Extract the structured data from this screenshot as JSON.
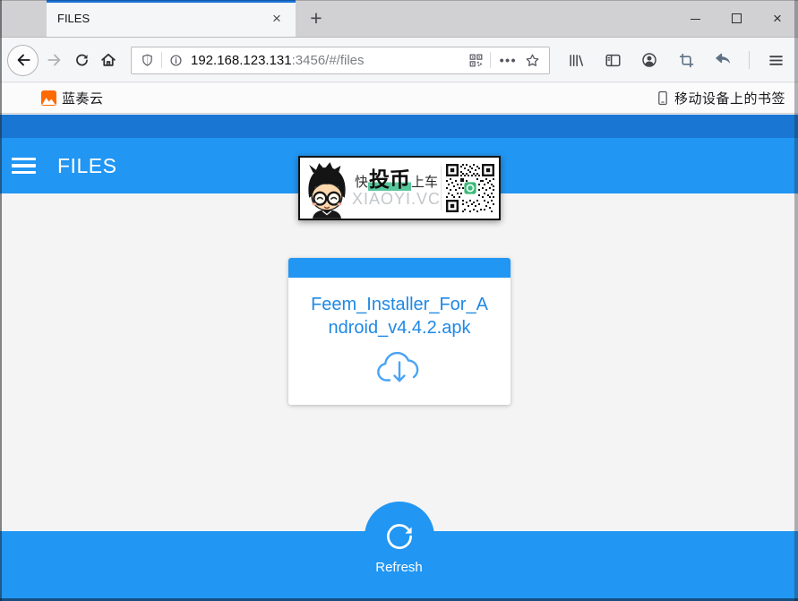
{
  "browser": {
    "tabbar": {
      "active_tab_title": "FILES"
    },
    "urlbar": {
      "host": "192.168.123.131",
      "path": ":3456/#/files"
    }
  },
  "bookmarks_bar": {
    "left_item_label": "蓝奏云",
    "right_item_label": "移动设备上的书签"
  },
  "app": {
    "header_title": "FILES",
    "banner": {
      "tagline_prefix": "快",
      "tagline_highlight": "投币",
      "tagline_suffix": "上车",
      "site": "XIAOYI.VC"
    },
    "file_card": {
      "filename": "Feem_Installer_For_Android_v4.4.2.apk"
    },
    "footer": {
      "refresh_label": "Refresh"
    }
  },
  "icons": {
    "new_tab": "+",
    "tab_close": "×",
    "window_close": "×",
    "page_actions_dots": "•••"
  },
  "colors": {
    "primary_blue": "#2196f3",
    "dark_blue": "#1976d2",
    "filename_blue": "#1e88e5",
    "download_icon_blue": "#4aa3f5",
    "active_tab_line": "#1a73d9",
    "highlight_green": "#58c79c",
    "qr_badge_green": "#3cb878",
    "favicon_orange": "#ff6a00"
  }
}
